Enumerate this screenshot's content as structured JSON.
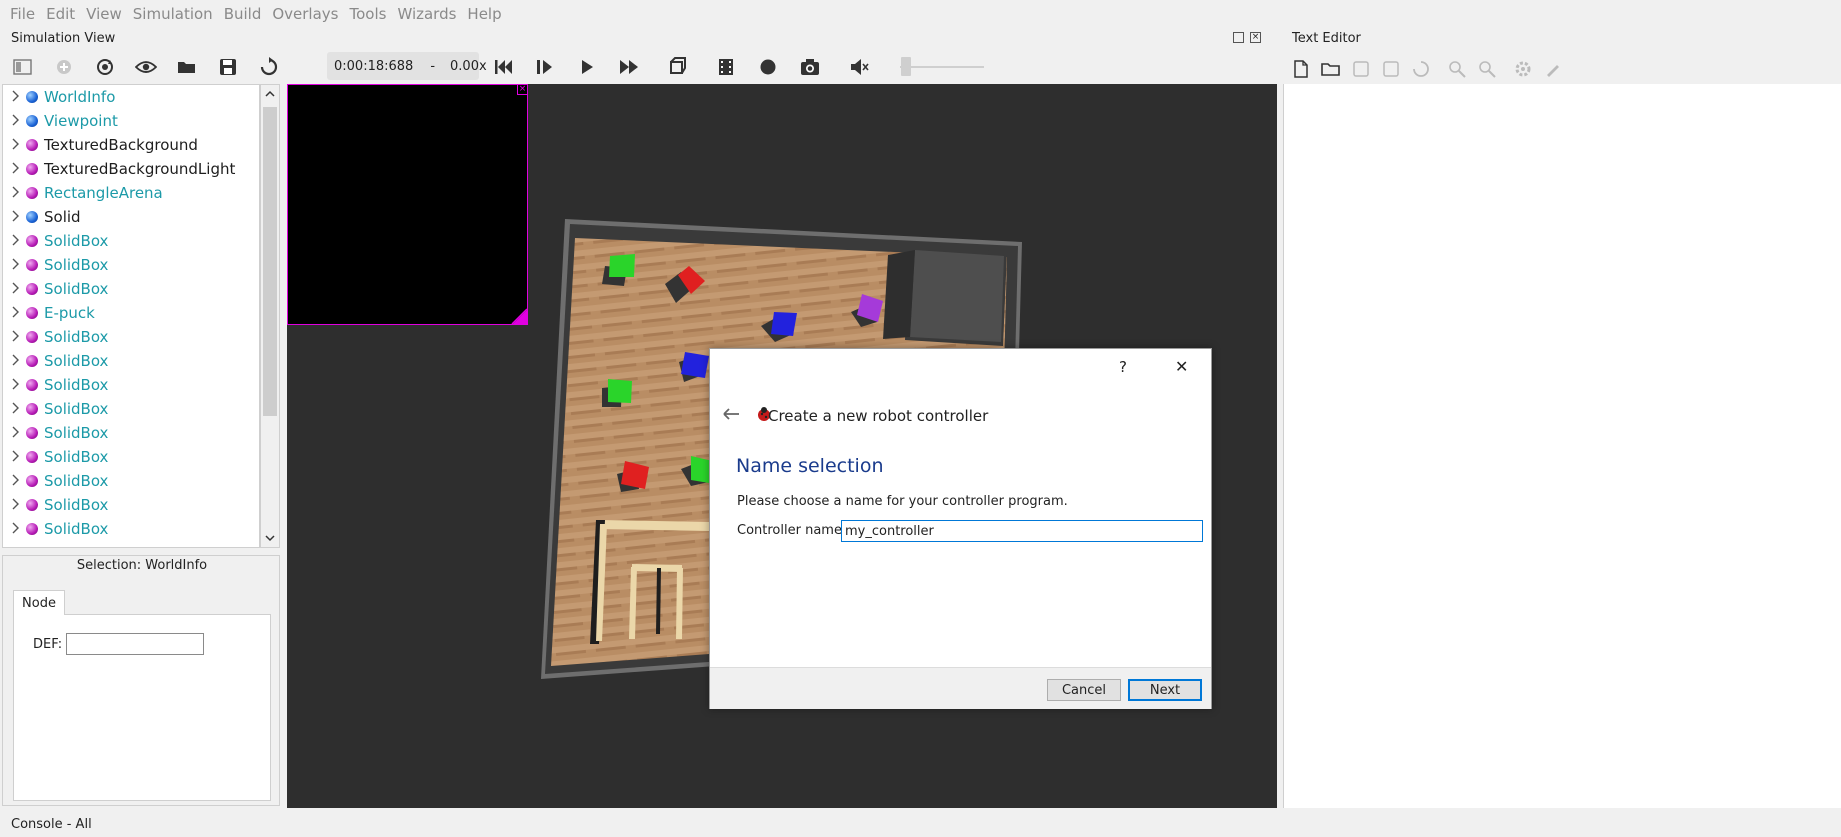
{
  "menubar": {
    "items": [
      "File",
      "Edit",
      "View",
      "Simulation",
      "Build",
      "Overlays",
      "Tools",
      "Wizards",
      "Help"
    ]
  },
  "simulation_view": {
    "title": "Simulation View",
    "time": "0:00:18:688",
    "separator": "-",
    "speed": "0.00x",
    "volume_level": 0
  },
  "text_editor": {
    "title": "Text Editor"
  },
  "scene_tree": {
    "items": [
      {
        "label": "WorldInfo",
        "color": "blue",
        "style": "teal"
      },
      {
        "label": "Viewpoint",
        "color": "blue",
        "style": "teal"
      },
      {
        "label": "TexturedBackground",
        "color": "purple",
        "style": "dark"
      },
      {
        "label": "TexturedBackgroundLight",
        "color": "purple",
        "style": "dark"
      },
      {
        "label": "RectangleArena",
        "color": "purple",
        "style": "teal"
      },
      {
        "label": "Solid",
        "color": "blue",
        "style": "dark"
      },
      {
        "label": "SolidBox",
        "color": "purple",
        "style": "teal"
      },
      {
        "label": "SolidBox",
        "color": "purple",
        "style": "teal"
      },
      {
        "label": "SolidBox",
        "color": "purple",
        "style": "teal"
      },
      {
        "label": "E-puck",
        "color": "purple",
        "style": "teal"
      },
      {
        "label": "SolidBox",
        "color": "purple",
        "style": "teal"
      },
      {
        "label": "SolidBox",
        "color": "purple",
        "style": "teal"
      },
      {
        "label": "SolidBox",
        "color": "purple",
        "style": "teal"
      },
      {
        "label": "SolidBox",
        "color": "purple",
        "style": "teal"
      },
      {
        "label": "SolidBox",
        "color": "purple",
        "style": "teal"
      },
      {
        "label": "SolidBox",
        "color": "purple",
        "style": "teal"
      },
      {
        "label": "SolidBox",
        "color": "purple",
        "style": "teal"
      },
      {
        "label": "SolidBox",
        "color": "purple",
        "style": "teal"
      },
      {
        "label": "SolidBox",
        "color": "purple",
        "style": "teal"
      }
    ]
  },
  "selection_panel": {
    "title": "Selection: WorldInfo",
    "tab": "Node",
    "def_label": "DEF:",
    "def_value": ""
  },
  "console": {
    "title": "Console - All"
  },
  "dialog": {
    "help": "?",
    "close": "✕",
    "title": "Create a new robot controller",
    "heading": "Name selection",
    "description": "Please choose a name for your controller program.",
    "field_label": "Controller name:",
    "field_value": "my_controller",
    "cancel_label": "Cancel",
    "next_label": "Next"
  },
  "colors": {
    "accent": "#0078d7",
    "tree_teal": "#1c9aa8",
    "heading_blue": "#1a3b8c",
    "overlay_magenta": "#e000e0"
  }
}
